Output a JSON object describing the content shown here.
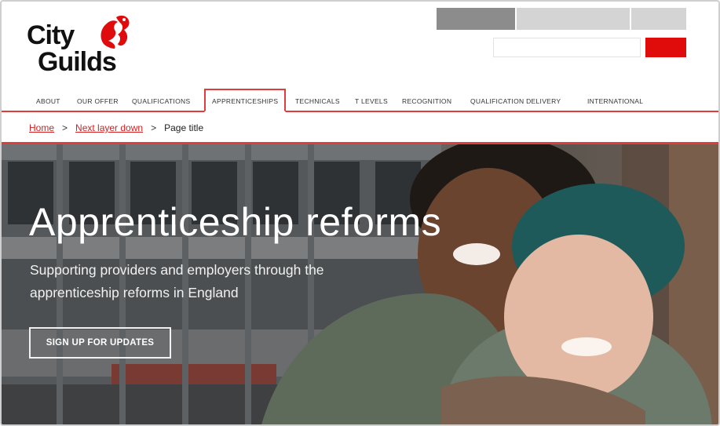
{
  "brand": {
    "line1": "City",
    "line2": "Guilds",
    "accent": "#e00b0b"
  },
  "search": {
    "placeholder": "",
    "value": ""
  },
  "nav": {
    "items": [
      {
        "label": "ABOUT"
      },
      {
        "label": "OUR OFFER"
      },
      {
        "label": "QUALIFICATIONS"
      },
      {
        "label": "APPRENTICESHIPS",
        "active": true
      },
      {
        "label": "TECHNICALS"
      },
      {
        "label": "T LEVELS"
      },
      {
        "label": "RECOGNITION"
      },
      {
        "label": "QUALIFICATION DELIVERY"
      },
      {
        "label": "INTERNATIONAL"
      }
    ]
  },
  "breadcrumb": {
    "home": "Home",
    "sep": ">",
    "level2": "Next layer down",
    "current": "Page title"
  },
  "hero": {
    "title": "Apprenticeship reforms",
    "subtitle": "Supporting providers and employers through the apprenticeship reforms in England",
    "cta": "SIGN UP FOR UPDATES"
  },
  "colors": {
    "nav_accent": "#e03c3c",
    "link": "#d42020"
  }
}
